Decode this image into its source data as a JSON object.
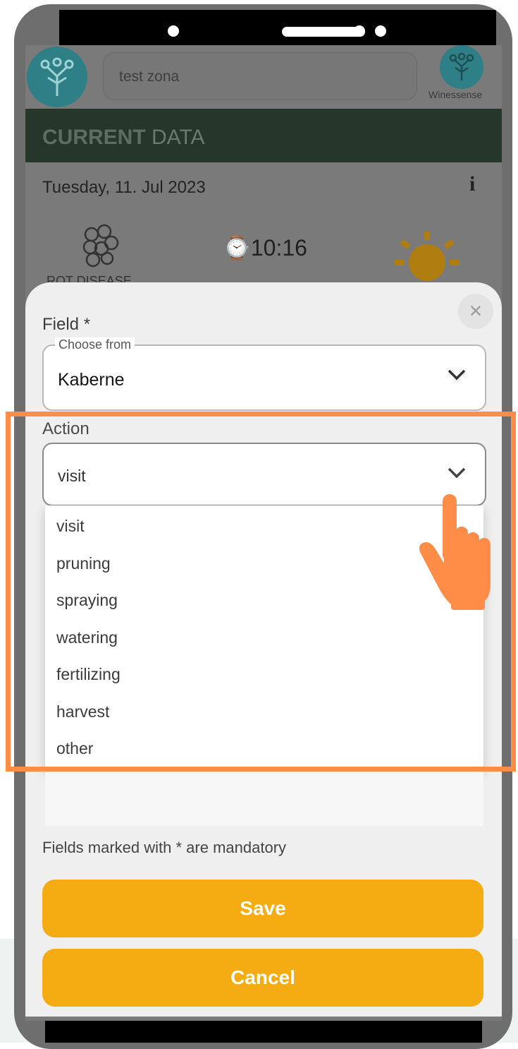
{
  "header": {
    "zone_value": "test zona",
    "brand": "Winessense"
  },
  "current_data": {
    "title_bold": "CURRENT",
    "title_rest": " DATA",
    "date": "Tuesday, 11. Jul 2023",
    "info": "i",
    "time": "⌚10:16",
    "rot_label": "ROT DISEASE"
  },
  "form": {
    "close": "×",
    "field_label": "Field *",
    "field_legend": "Choose from",
    "field_value": "Kaberne",
    "action_label": "Action",
    "action_value": "visit",
    "action_options": [
      "visit",
      "pruning",
      "spraying",
      "watering",
      "fertilizing",
      "harvest",
      "other"
    ],
    "mandatory_note": "Fields marked with * are mandatory",
    "save_label": "Save",
    "cancel_label": "Cancel"
  },
  "colors": {
    "accent_button": "#f5ab12",
    "highlight": "#ff8c47",
    "header_band": "#26362b",
    "logo": "#2e7f86"
  },
  "icons": [
    "logo-icon",
    "grapes-icon",
    "clock-icon",
    "sun-icon",
    "info-icon",
    "close-icon",
    "chevron-down-icon",
    "pointing-hand-icon"
  ]
}
